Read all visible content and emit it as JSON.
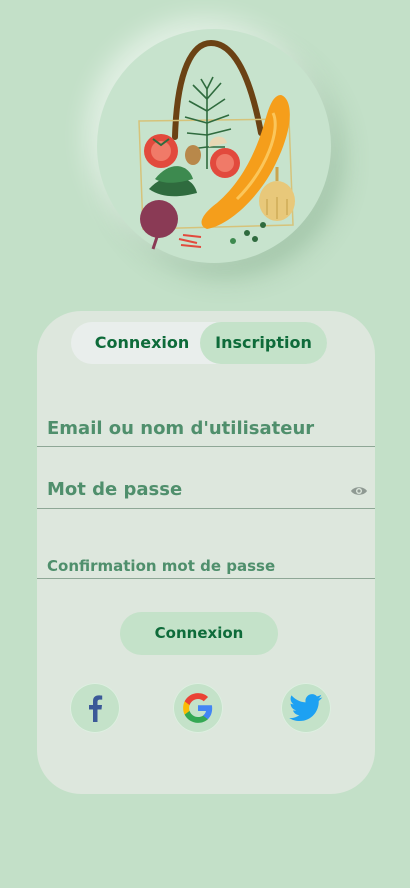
{
  "tabs": {
    "login": "Connexion",
    "signup": "Inscription",
    "active": "signup"
  },
  "form": {
    "email_label": "Email ou nom d'utilisateur",
    "password_label": "Mot de passe",
    "confirm_label": "Confirmation mot de passe"
  },
  "actions": {
    "submit": "Connexion"
  },
  "social": [
    {
      "name": "facebook",
      "icon": "facebook-icon",
      "color": "#3b5998"
    },
    {
      "name": "google",
      "icon": "google-icon",
      "color": "#4285f4"
    },
    {
      "name": "twitter",
      "icon": "twitter-icon",
      "color": "#1da1f2"
    }
  ],
  "colors": {
    "background": "#c3e0c8",
    "card": "#dde7dd",
    "accent": "#0e6b3a",
    "field_text": "#4f8f6c"
  }
}
